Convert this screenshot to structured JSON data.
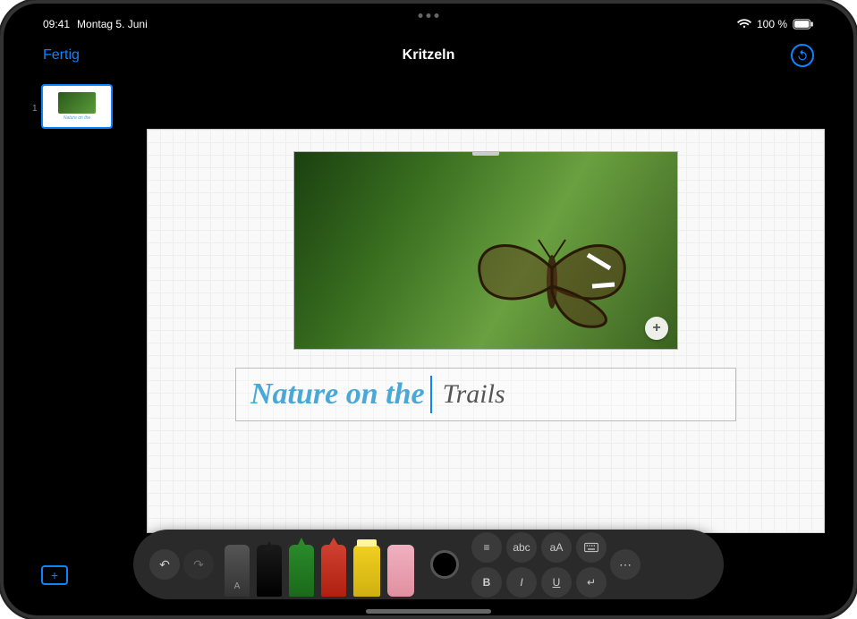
{
  "status": {
    "time": "09:41",
    "date": "Montag 5. Juni",
    "battery_pct": "100 %"
  },
  "nav": {
    "done_label": "Fertig",
    "title": "Kritzeln"
  },
  "thumbnail": {
    "number": "1",
    "caption": "Nature on the"
  },
  "slide": {
    "typed_text": "Nature on the",
    "handwritten_text": "Trails"
  },
  "tray": {
    "undo": "↶",
    "redo": "↷",
    "align": "≡",
    "abc": "abc",
    "aA": "aA",
    "keyboard": "⌨",
    "bold": "B",
    "italic": "I",
    "underline": "U",
    "return": "↵",
    "more": "⋯"
  }
}
